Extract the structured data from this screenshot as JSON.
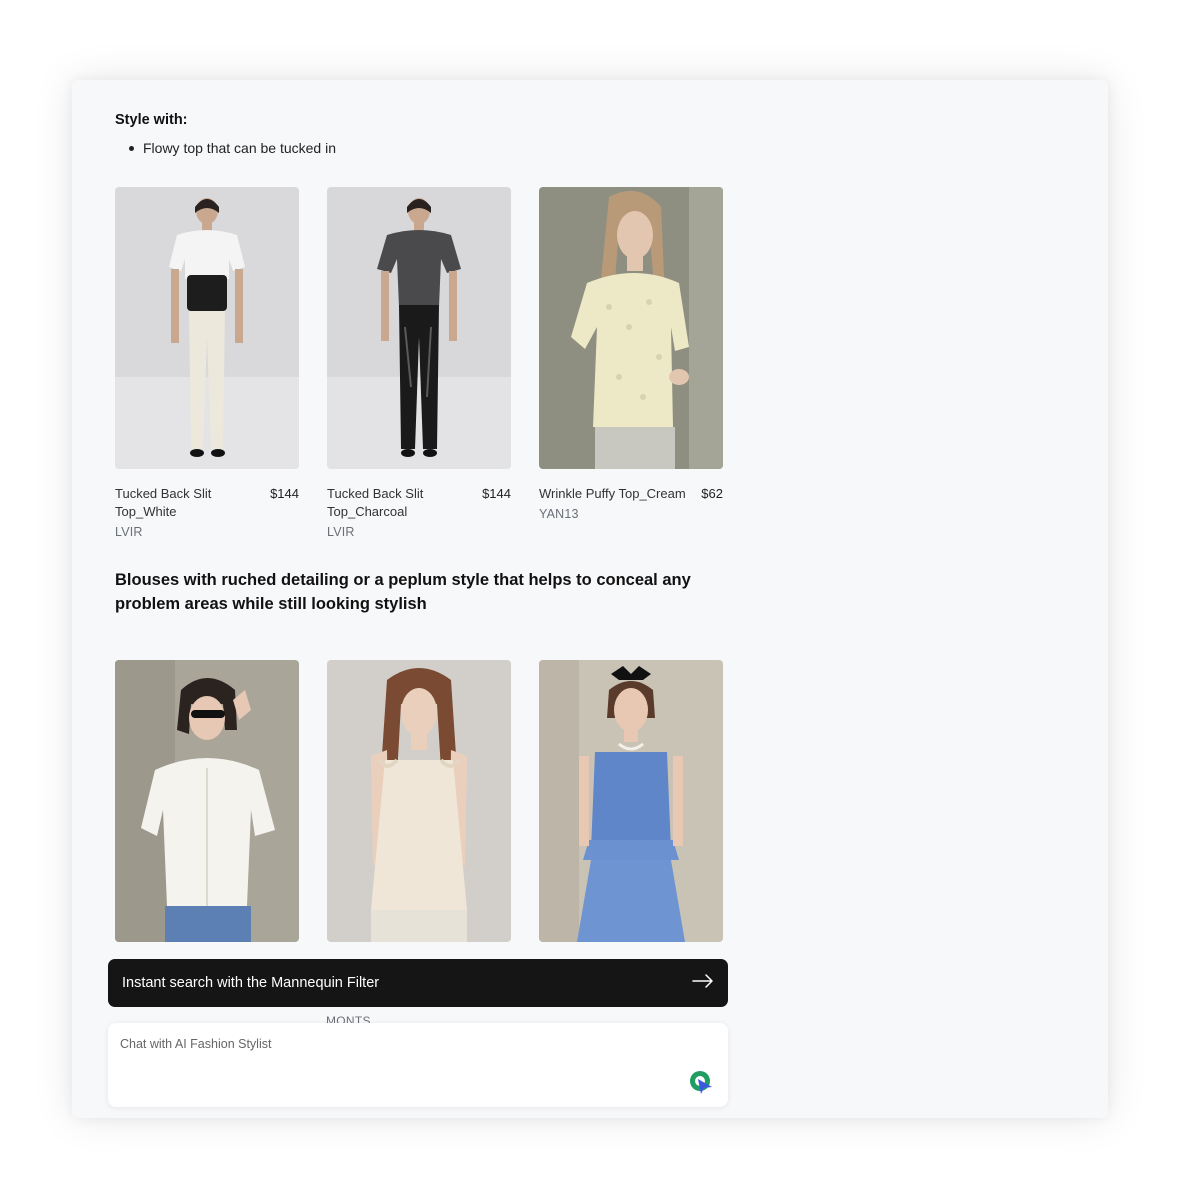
{
  "section1": {
    "heading": "Style with:",
    "bullets": [
      "Flowy top that can be tucked in"
    ],
    "products": [
      {
        "name": "Tucked Back Slit Top_White",
        "price": "$144",
        "brand": "LVIR",
        "image": "model-white-tee-leather-corset"
      },
      {
        "name": "Tucked Back Slit Top_Charcoal",
        "price": "$144",
        "brand": "LVIR",
        "image": "model-charcoal-top-leather-pants"
      },
      {
        "name": "Wrinkle Puffy Top_Cream",
        "price": "$62",
        "brand": "YAN13",
        "image": "model-cream-textured-top"
      }
    ]
  },
  "section2": {
    "title": "Blouses with ruched detailing or a peplum style that helps to conceal any problem areas while still looking stylish",
    "products": [
      {
        "image": "model-white-eyelet-blouse"
      },
      {
        "image": "model-ivory-ruffle-cami"
      },
      {
        "image": "model-blue-peplum-top"
      }
    ],
    "partially_hidden_brand": "MONTS"
  },
  "cta": {
    "label": "Instant search with the Mannequin Filter",
    "icon": "arrow-right-icon"
  },
  "chat": {
    "placeholder": "Chat with AI Fashion Stylist",
    "send_icon": "send-icon"
  },
  "colors": {
    "background": "#f7f8fa",
    "cta_bg": "#151515",
    "accent_green": "#1f9d63",
    "accent_blue": "#3b5bdb"
  }
}
